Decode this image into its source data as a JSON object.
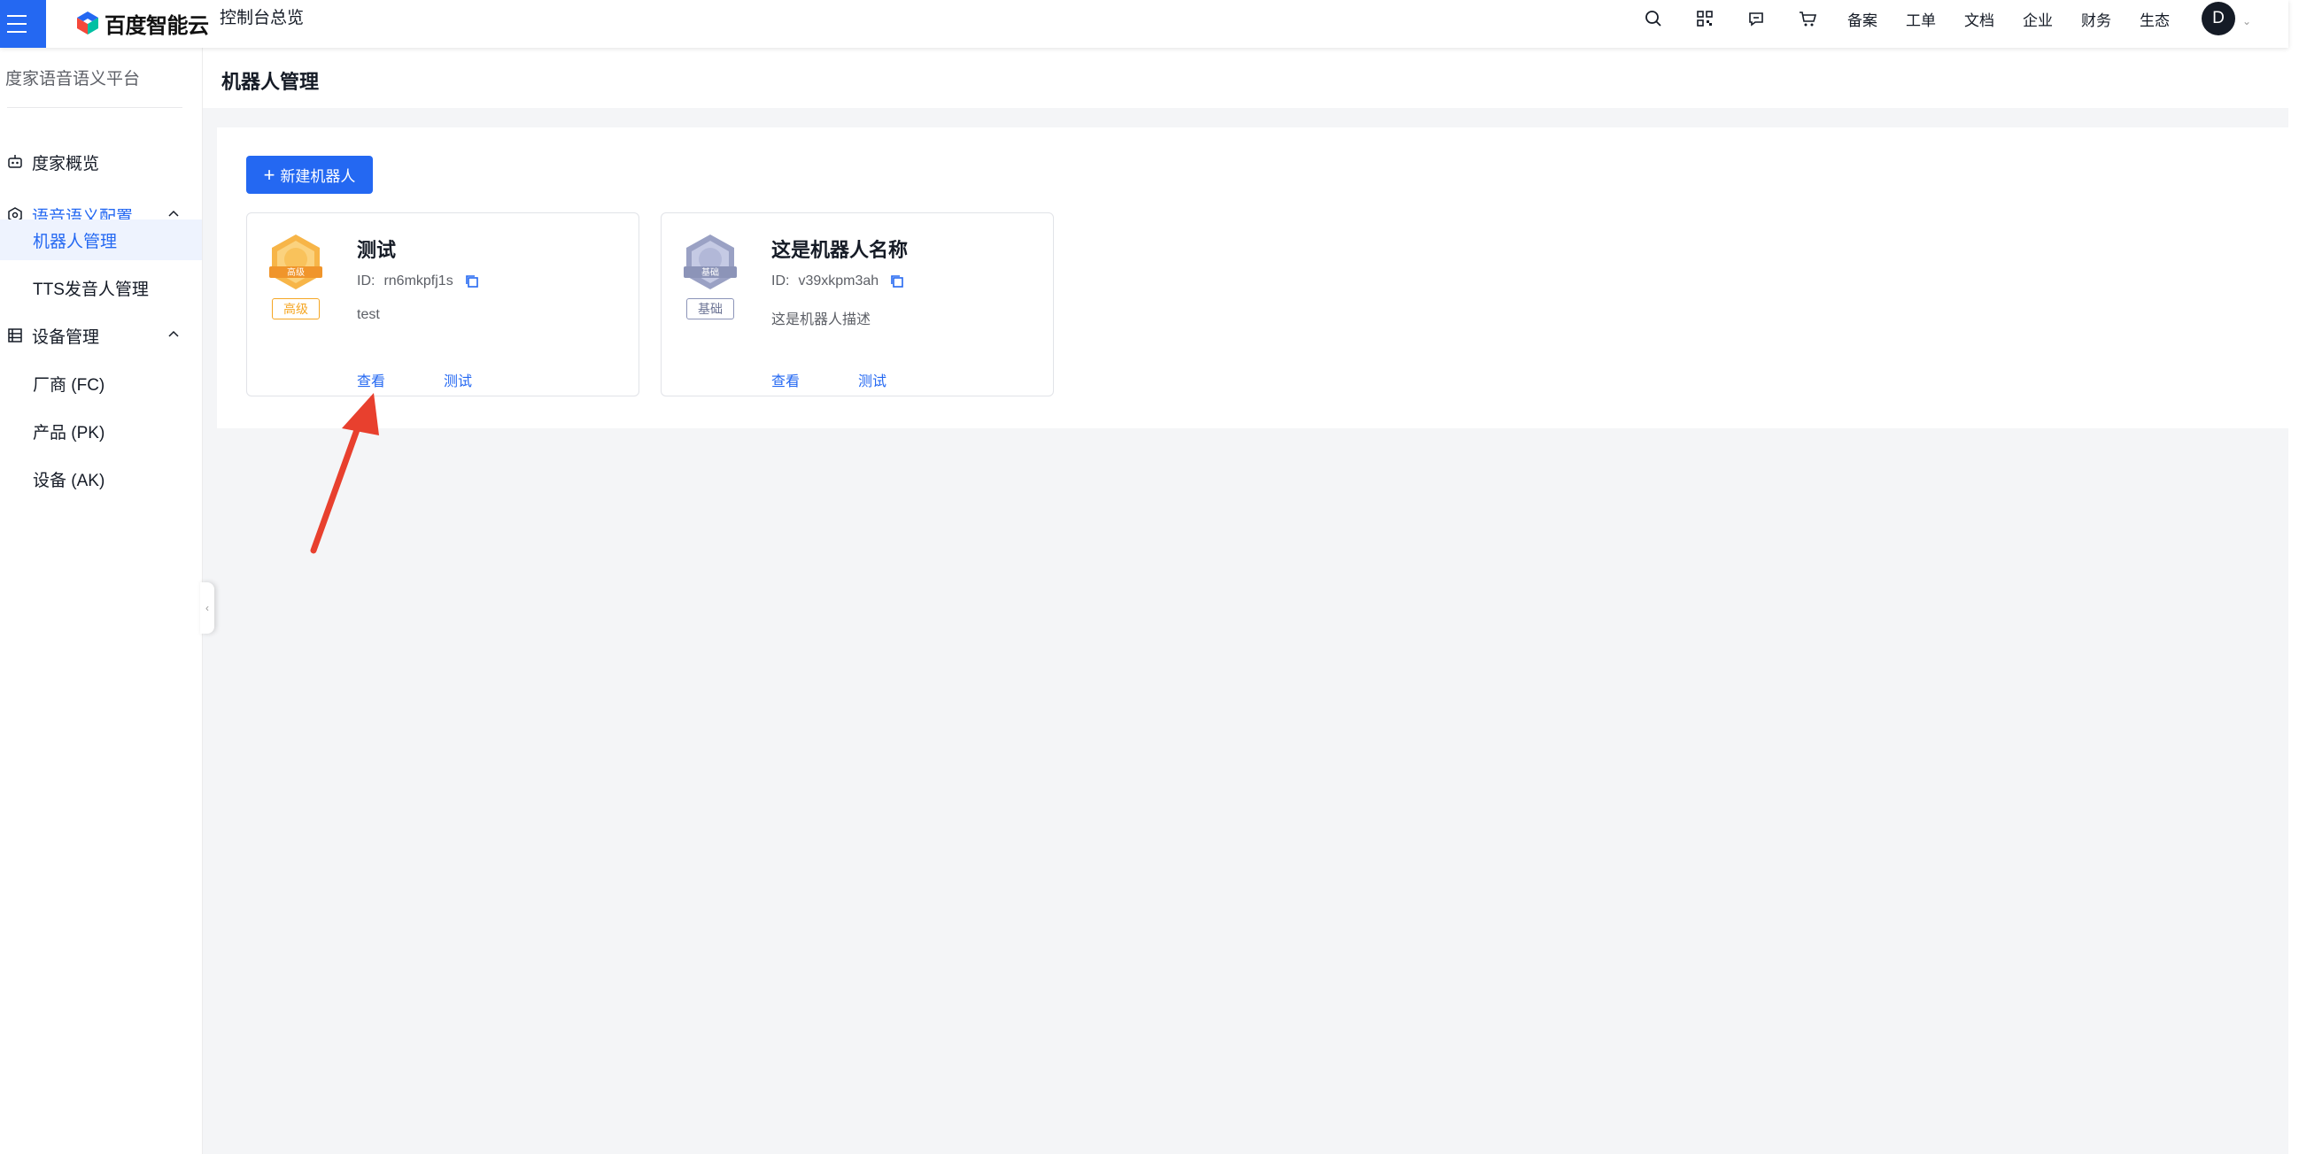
{
  "topbar": {
    "brand": "百度智能云",
    "console_title": "控制台总览",
    "icons": [
      "search-icon",
      "qrcode-icon",
      "message-icon",
      "cart-icon"
    ],
    "nav": [
      "备案",
      "工单",
      "文档",
      "企业",
      "财务",
      "生态"
    ],
    "avatar_letter": "D"
  },
  "sidebar": {
    "title": "度家语音语义平台",
    "items": [
      {
        "label": "度家概览",
        "icon": "robot-icon"
      },
      {
        "label": "语音语义配置",
        "icon": "settings-hex-icon"
      },
      {
        "label": "机器人管理"
      },
      {
        "label": "TTS发音人管理"
      },
      {
        "label": "设备管理",
        "icon": "device-list-icon"
      },
      {
        "label": "厂商 (FC)"
      },
      {
        "label": "产品 (PK)"
      },
      {
        "label": "设备 (AK)"
      }
    ]
  },
  "main": {
    "page_title": "机器人管理",
    "new_button": "新建机器人",
    "cards": [
      {
        "name": "测试",
        "id_label": "ID:",
        "id_value": "rn6mkpfj1s",
        "description": "test",
        "badge_text": "高级",
        "level_tag": "高级",
        "view_label": "查看",
        "test_label": "测试"
      },
      {
        "name": "这是机器人名称",
        "id_label": "ID:",
        "id_value": "v39xkpm3ah",
        "description": "这是机器人描述",
        "badge_text": "基础",
        "level_tag": "基础",
        "view_label": "查看",
        "test_label": "测试"
      }
    ]
  },
  "colors": {
    "primary": "#2468f2",
    "gold": "#f5a623",
    "silver": "#8c94b8",
    "arrow": "#e8402e"
  }
}
